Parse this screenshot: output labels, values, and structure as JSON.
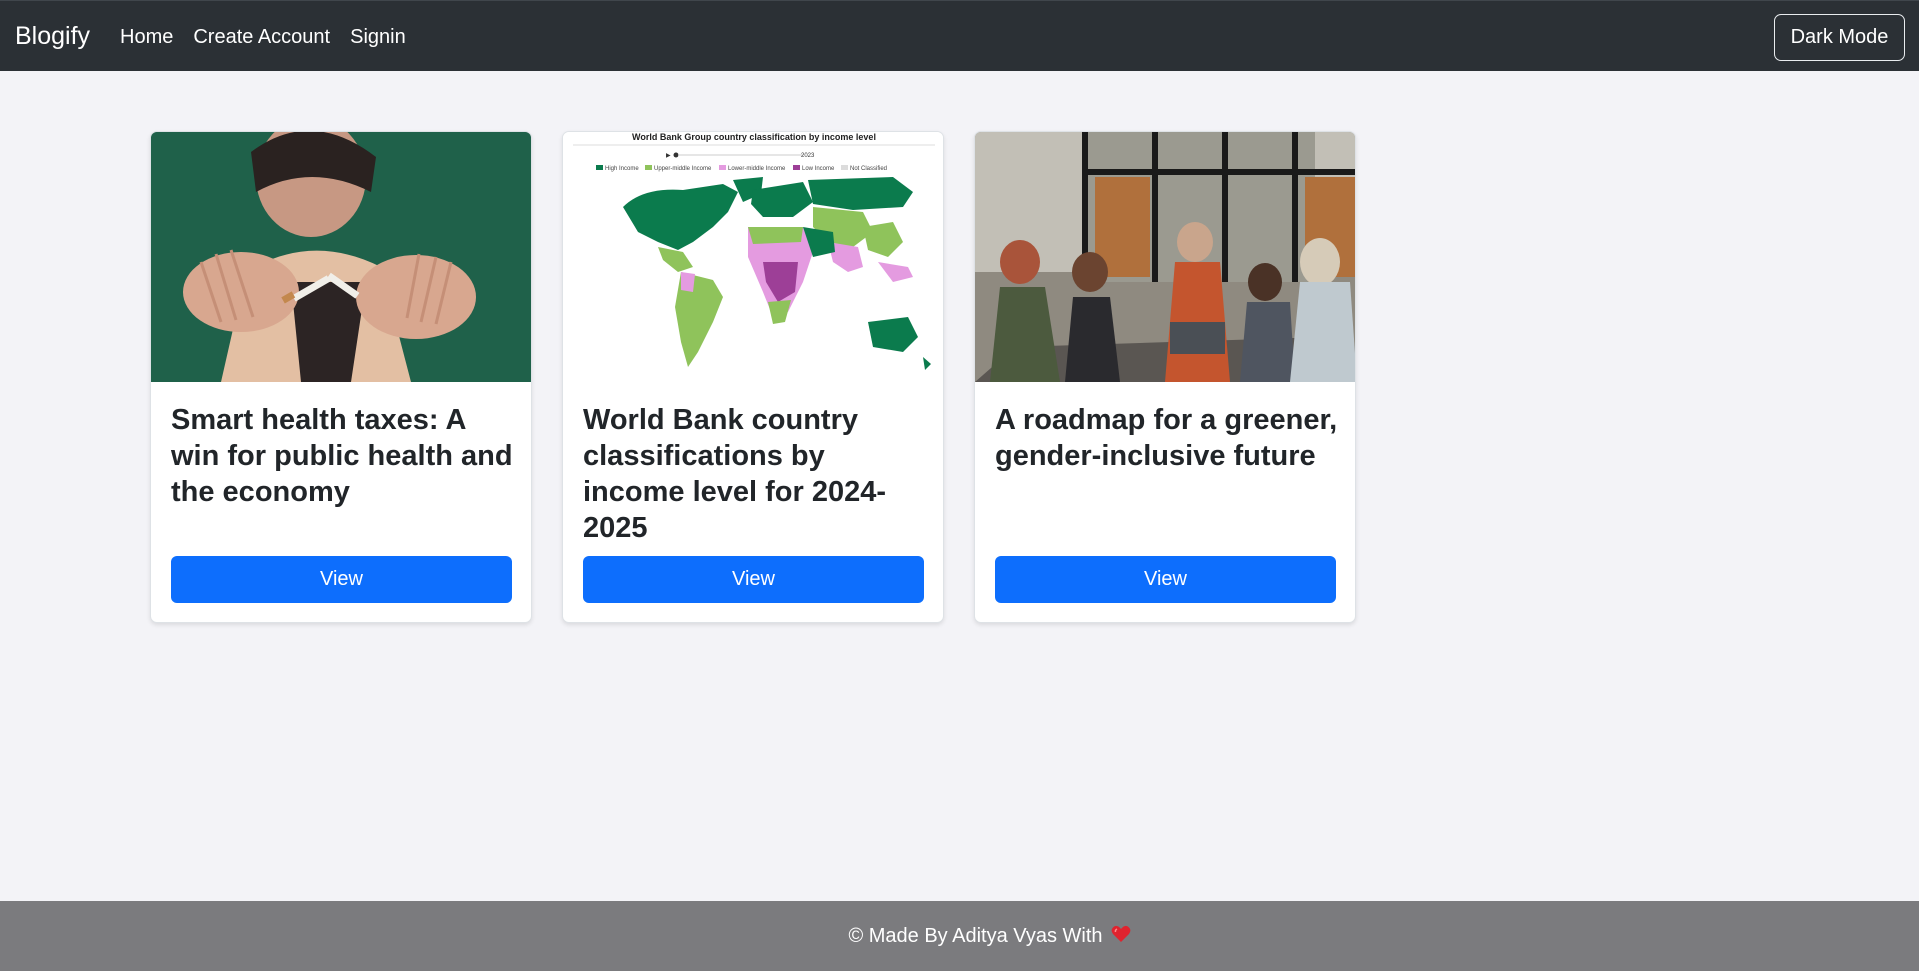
{
  "navbar": {
    "brand": "Blogify",
    "links": [
      {
        "label": "Home"
      },
      {
        "label": "Create Account"
      },
      {
        "label": "Signin"
      }
    ],
    "dark_mode_label": "Dark Mode"
  },
  "cards": [
    {
      "title": "Smart health taxes: A win for public health and the economy",
      "button_label": "View",
      "image": "woman-breaking-cigarette-photo"
    },
    {
      "title": "World Bank country classifications by income level for 2024-2025",
      "button_label": "View",
      "image": "world-income-classification-map",
      "map": {
        "title": "World Bank Group country classification by income level",
        "year": "2023",
        "legend": [
          {
            "label": "High Income",
            "color": "#0b7b4d"
          },
          {
            "label": "Upper-middle Income",
            "color": "#8fc35b"
          },
          {
            "label": "Lower-middle Income",
            "color": "#e49be0"
          },
          {
            "label": "Low Income",
            "color": "#9d3f97"
          },
          {
            "label": "Not Classified",
            "color": "#dcdcdc"
          }
        ]
      }
    },
    {
      "title": "A roadmap for a greener, gender-inclusive future",
      "button_label": "View",
      "image": "office-meeting-photo"
    }
  ],
  "footer": {
    "text": "© Made By Aditya Vyas With",
    "heart_icon": "heart-icon"
  },
  "colors": {
    "navbar_bg": "#2b3035",
    "page_bg": "#f3f3f7",
    "primary": "#0d6efd",
    "footer_bg": "#7b7b7e"
  }
}
